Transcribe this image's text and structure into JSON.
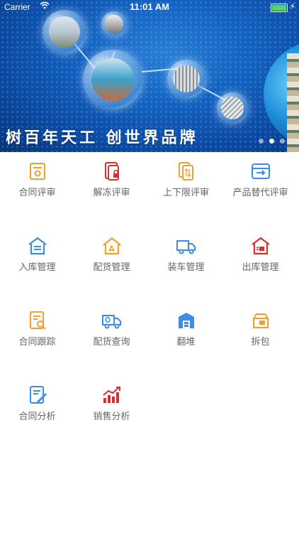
{
  "status_bar": {
    "carrier": "Carrier",
    "time": "11:01 AM"
  },
  "banner": {
    "slogan": "树百年天工 创世界品牌"
  },
  "menu": [
    {
      "label": "合同评审",
      "icon": "contract-review-icon",
      "color": "#f0a030"
    },
    {
      "label": "解冻评审",
      "icon": "unfreeze-review-icon",
      "color": "#d63030"
    },
    {
      "label": "上下限评审",
      "icon": "limit-review-icon",
      "color": "#f0a030"
    },
    {
      "label": "产品替代评审",
      "icon": "product-substitute-icon",
      "color": "#3a8ee6"
    },
    {
      "label": "入库管理",
      "icon": "warehouse-in-icon",
      "color": "#3a8ee6"
    },
    {
      "label": "配货管理",
      "icon": "distribution-icon",
      "color": "#f0a030"
    },
    {
      "label": "装车管理",
      "icon": "truck-loading-icon",
      "color": "#3a8ee6"
    },
    {
      "label": "出库管理",
      "icon": "warehouse-out-icon",
      "color": "#d63030"
    },
    {
      "label": "合同跟踪",
      "icon": "contract-track-icon",
      "color": "#f0a030"
    },
    {
      "label": "配货查询",
      "icon": "distribution-query-icon",
      "color": "#3a8ee6"
    },
    {
      "label": "翻堆",
      "icon": "restack-icon",
      "color": "#3a8ee6"
    },
    {
      "label": "拆包",
      "icon": "unpack-icon",
      "color": "#f0a030"
    },
    {
      "label": "合同分析",
      "icon": "contract-analysis-icon",
      "color": "#3a8ee6"
    },
    {
      "label": "销售分析",
      "icon": "sales-analysis-icon",
      "color": "#d63030"
    }
  ]
}
